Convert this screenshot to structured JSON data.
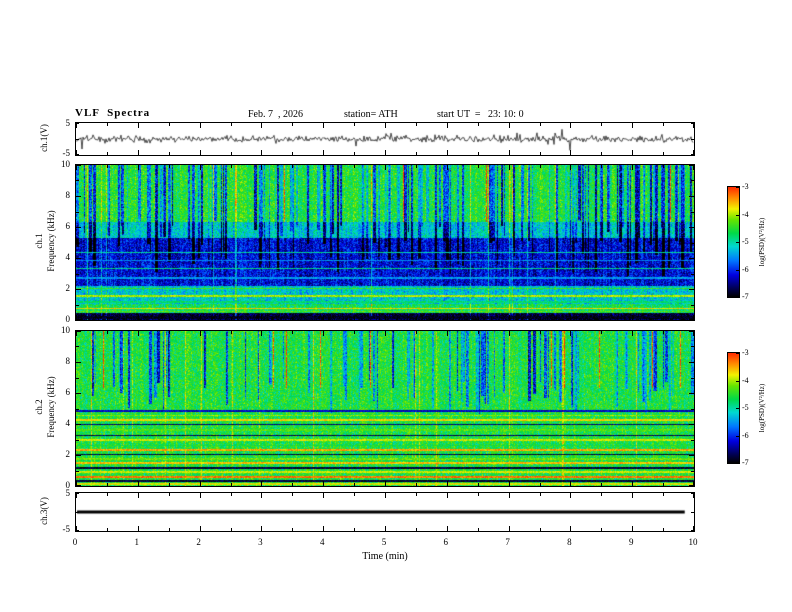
{
  "header": {
    "title": "VLF  Spectra",
    "date": "Feb. 7  , 2026",
    "station": "station= ATH",
    "start_ut": "start UT  =   23: 10: 0"
  },
  "x_axis": {
    "label": "Time  (min)",
    "tick_labels": [
      "0",
      "1",
      "2",
      "3",
      "4",
      "5",
      "6",
      "7",
      "8",
      "9",
      "10"
    ]
  },
  "panels": {
    "ch1_wave": {
      "ylabel": "ch.1(V)",
      "ytick_labels": [
        "5",
        "-5"
      ]
    },
    "ch1_spec": {
      "channel": "ch.1",
      "ylabel": "Frequency  (kHz)",
      "ytick_labels": [
        "10",
        "8",
        "6",
        "4",
        "2",
        "0"
      ]
    },
    "ch2_spec": {
      "channel": "ch.2",
      "ylabel": "Frequency  (kHz)",
      "ytick_labels": [
        "10",
        "8",
        "6",
        "4",
        "2",
        "0"
      ]
    },
    "ch3_wave": {
      "ylabel": "ch.3(V)",
      "ytick_labels": [
        "5",
        "-5"
      ]
    }
  },
  "colorbar": {
    "label": "log(PSD)(V²/Hz)",
    "tick_labels": [
      "-3",
      "-4",
      "-5",
      "-6",
      "-7"
    ],
    "stops": [
      {
        "t": 0.0,
        "color": "#000000"
      },
      {
        "t": 0.08,
        "color": "#000055"
      },
      {
        "t": 0.2,
        "color": "#0000e0"
      },
      {
        "t": 0.33,
        "color": "#0077ff"
      },
      {
        "t": 0.46,
        "color": "#00d9d0"
      },
      {
        "t": 0.58,
        "color": "#00d948"
      },
      {
        "t": 0.7,
        "color": "#64e400"
      },
      {
        "t": 0.8,
        "color": "#f2f200"
      },
      {
        "t": 0.9,
        "color": "#ff8c00"
      },
      {
        "t": 1.0,
        "color": "#ff2a00"
      }
    ]
  },
  "chart_data": [
    {
      "id": "ch1_waveform",
      "type": "line",
      "title": "ch.1(V) broadband time series",
      "xlabel": "Time (min)",
      "xlim": [
        0,
        10
      ],
      "ylim": [
        -5,
        5
      ],
      "description": "Continuous noise waveform centered on 0 V, typical excursions about ±1.5 V with frequent spikes to roughly ±3 V over the 10 minute record.",
      "seed": 3,
      "noise_amplitude": 0.9,
      "spike_probability": 0.035,
      "spike_amplitude": 1.8
    },
    {
      "id": "ch1_spectrogram",
      "type": "heatmap",
      "title": "ch.1 VLF spectrogram",
      "xlabel": "Time (min)",
      "ylabel": "Frequency (kHz)",
      "zlabel": "log(PSD)(V²/Hz)",
      "xlim": [
        0,
        10
      ],
      "ylim": [
        0,
        10
      ],
      "zlim": [
        -7,
        -3
      ],
      "description": "Green background (~-4.5) above ~6.5 kHz crossed by many dark-blue vertical sferic streaks reaching down to 3-6 kHz; broad dark-blue band (~-6.2) between ~2.2 and 5.5 kHz with faint lighter horizontal lines; mixed blue-green below 2.2 kHz with bright green/orange lines near 0.5-1 kHz; near-black band (~-7) below ~0.4 kHz.",
      "seed": 7,
      "column_noise": 0.22,
      "pixel_noise": 0.45,
      "bands": [
        {
          "f0": 6.3,
          "f1": 10.0,
          "level": -4.55
        },
        {
          "f0": 5.3,
          "f1": 6.3,
          "level": -5.2
        },
        {
          "f0": 2.15,
          "f1": 5.3,
          "level": -6.2
        },
        {
          "f0": 1.0,
          "f1": 2.15,
          "level": -5.2
        },
        {
          "f0": 0.42,
          "f1": 1.0,
          "level": -4.7
        },
        {
          "f0": 0.0,
          "f1": 0.42,
          "level": -6.8
        }
      ],
      "stripes": [
        {
          "f": 4.35,
          "halfwidth": 0.05,
          "level": -5.0
        },
        {
          "f": 3.85,
          "halfwidth": 0.04,
          "level": -5.6
        },
        {
          "f": 3.3,
          "halfwidth": 0.05,
          "level": -4.9
        },
        {
          "f": 2.7,
          "halfwidth": 0.04,
          "level": -5.5
        },
        {
          "f": 2.0,
          "halfwidth": 0.05,
          "level": -4.4
        },
        {
          "f": 1.55,
          "halfwidth": 0.06,
          "level": -4.0
        },
        {
          "f": 1.15,
          "halfwidth": 0.05,
          "level": -4.8
        },
        {
          "f": 0.72,
          "halfwidth": 0.05,
          "level": -3.7
        },
        {
          "f": 0.5,
          "halfwidth": 0.04,
          "level": -4.3
        },
        {
          "f": 0.15,
          "halfwidth": 0.09,
          "level": -6.9
        }
      ],
      "streaks": {
        "probability": 0.2,
        "fmin_range": [
          2.8,
          6.5
        ],
        "strength_range": [
          -2.2,
          -0.8
        ],
        "bright_probability": 0.05,
        "bright_strength": 0.7,
        "hot_probability": 0.012,
        "hot_strength": 1.5
      }
    },
    {
      "id": "ch2_spectrogram",
      "type": "heatmap",
      "title": "ch.2 VLF spectrogram",
      "xlabel": "Time (min)",
      "ylabel": "Frequency (kHz)",
      "zlabel": "log(PSD)(V²/Hz)",
      "xlim": [
        0,
        10
      ],
      "ylim": [
        0,
        10
      ],
      "zlim": [
        -7,
        -3
      ],
      "description": "Green background (~-4.6) above ~5 kHz with dark-blue vertical sferic streaks; below 5 kHz strong persistent horizontal banding: alternating green, yellow/orange-red lines (~2.3, 1.45, 0.55 kHz) and near-black lines (~4, 3.25, 2, 1.15, 0.3 kHz).",
      "seed": 41,
      "column_noise": 0.2,
      "pixel_noise": 0.45,
      "bands": [
        {
          "f0": 5.0,
          "f1": 10.0,
          "level": -4.6
        },
        {
          "f0": 0.0,
          "f1": 5.0,
          "level": -4.6
        }
      ],
      "stripes": [
        {
          "f": 4.85,
          "halfwidth": 0.07,
          "level": -6.3
        },
        {
          "f": 4.55,
          "halfwidth": 0.05,
          "level": -4.1
        },
        {
          "f": 4.25,
          "halfwidth": 0.06,
          "level": -3.7
        },
        {
          "f": 3.95,
          "halfwidth": 0.05,
          "level": -6.6
        },
        {
          "f": 3.6,
          "halfwidth": 0.06,
          "level": -4.3
        },
        {
          "f": 3.25,
          "halfwidth": 0.05,
          "level": -6.7
        },
        {
          "f": 2.95,
          "halfwidth": 0.06,
          "level": -3.9
        },
        {
          "f": 2.6,
          "halfwidth": 0.05,
          "level": -4.6
        },
        {
          "f": 2.3,
          "halfwidth": 0.06,
          "level": -3.5
        },
        {
          "f": 2.0,
          "halfwidth": 0.05,
          "level": -6.8
        },
        {
          "f": 1.7,
          "halfwidth": 0.06,
          "level": -4.2
        },
        {
          "f": 1.45,
          "halfwidth": 0.05,
          "level": -3.6
        },
        {
          "f": 1.15,
          "halfwidth": 0.05,
          "level": -6.8
        },
        {
          "f": 0.85,
          "halfwidth": 0.06,
          "level": -3.9
        },
        {
          "f": 0.55,
          "halfwidth": 0.05,
          "level": -3.3
        },
        {
          "f": 0.3,
          "halfwidth": 0.07,
          "level": -6.8
        },
        {
          "f": 0.1,
          "halfwidth": 0.05,
          "level": -3.8
        }
      ],
      "streaks": {
        "probability": 0.16,
        "fmin_range": [
          4.6,
          6.8
        ],
        "strength_range": [
          -2.0,
          -0.7
        ],
        "bright_probability": 0.04,
        "bright_strength": 0.6,
        "hot_probability": 0.012,
        "hot_strength": 1.5
      }
    },
    {
      "id": "ch3_waveform",
      "type": "line",
      "title": "ch.3(V) time series",
      "xlabel": "Time (min)",
      "xlim": [
        0,
        10
      ],
      "ylim": [
        -5,
        5
      ],
      "description": "Flat constant trace at ~0 V for the whole record (thick black line, channel inactive).",
      "constant_value": 0,
      "line_width": 3
    }
  ]
}
